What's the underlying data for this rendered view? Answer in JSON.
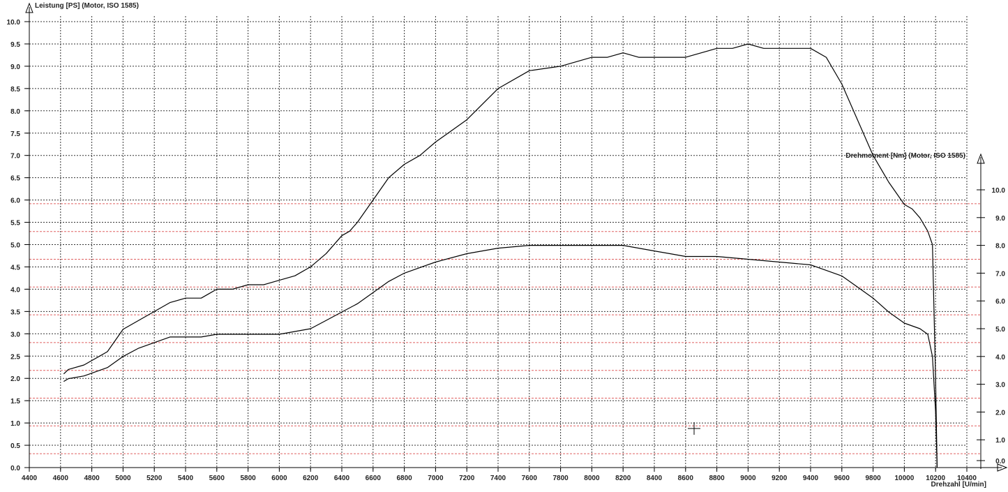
{
  "chart_data": {
    "type": "line",
    "ylabel_left": "Leistung [PS] (Motor, ISO 1585)",
    "ylabel_right": "Drehmoment [Nm] (Motor, ISO 1585)",
    "xlabel": "Drehzahl [U/min]",
    "xlim": [
      4400,
      10400
    ],
    "ylim_left": [
      0,
      10
    ],
    "ylim_right": [
      0,
      10
    ],
    "x_ticks": [
      "4400",
      "4600",
      "4800",
      "5000",
      "5200",
      "5400",
      "5600",
      "5800",
      "6000",
      "6200",
      "6400",
      "6600",
      "6800",
      "7000",
      "7200",
      "7400",
      "7600",
      "7800",
      "8000",
      "8200",
      "8400",
      "8600",
      "8800",
      "9000",
      "9200",
      "9400",
      "9600",
      "9800",
      "10000",
      "10200",
      "10400"
    ],
    "y_ticks_left": [
      "0.0",
      "0.5",
      "1.0",
      "1.5",
      "2.0",
      "2.5",
      "3.0",
      "3.5",
      "4.0",
      "4.5",
      "5.0",
      "5.5",
      "6.0",
      "6.5",
      "7.0",
      "7.5",
      "8.0",
      "8.5",
      "9.0",
      "9.5",
      "10.0"
    ],
    "y_ticks_right": [
      "0.0",
      "1.0",
      "2.0",
      "3.0",
      "4.0",
      "5.0",
      "6.0",
      "7.0",
      "8.0",
      "9.0",
      "10.0"
    ],
    "grid": true,
    "series": [
      {
        "axis": "left",
        "color": "#000000",
        "x": [
          4620,
          4650,
          4750,
          4800,
          4850,
          4900,
          5000,
          5100,
          5200,
          5300,
          5400,
          5500,
          5550,
          5600,
          5700,
          5800,
          5900,
          6000,
          6100,
          6200,
          6300,
          6400,
          6450,
          6500,
          6600,
          6700,
          6800,
          6900,
          7000,
          7200,
          7400,
          7600,
          7800,
          8000,
          8100,
          8200,
          8300,
          8400,
          8500,
          8600,
          8800,
          8900,
          9000,
          9100,
          9200,
          9300,
          9400,
          9500,
          9600,
          9700,
          9800,
          9900,
          10000,
          10050,
          10100,
          10150,
          10180,
          10200,
          10210
        ],
        "values": [
          2.1,
          2.2,
          2.3,
          2.4,
          2.5,
          2.6,
          3.1,
          3.3,
          3.5,
          3.7,
          3.8,
          3.8,
          3.9,
          4.0,
          4.0,
          4.1,
          4.1,
          4.2,
          4.3,
          4.5,
          4.8,
          5.2,
          5.3,
          5.5,
          6.0,
          6.5,
          6.8,
          7.0,
          7.3,
          7.8,
          8.5,
          8.9,
          9.0,
          9.2,
          9.2,
          9.3,
          9.2,
          9.2,
          9.2,
          9.2,
          9.4,
          9.4,
          9.5,
          9.4,
          9.4,
          9.4,
          9.4,
          9.2,
          8.6,
          7.8,
          7.0,
          6.4,
          5.9,
          5.8,
          5.6,
          5.3,
          5.0,
          2.0,
          0.0
        ]
      },
      {
        "axis": "right",
        "color": "#000000",
        "x": [
          4620,
          4650,
          4750,
          4800,
          4850,
          4900,
          5000,
          5100,
          5200,
          5300,
          5400,
          5500,
          5600,
          5700,
          5800,
          5900,
          6000,
          6100,
          6200,
          6300,
          6400,
          6500,
          6600,
          6700,
          6800,
          6900,
          7000,
          7200,
          7400,
          7600,
          7800,
          8000,
          8200,
          8300,
          8400,
          8500,
          8600,
          8700,
          8800,
          9000,
          9200,
          9400,
          9500,
          9600,
          9700,
          9800,
          9900,
          10000,
          10100,
          10150,
          10180,
          10200,
          10210
        ],
        "values": [
          3.1,
          3.2,
          3.3,
          3.4,
          3.5,
          3.6,
          4.0,
          4.3,
          4.5,
          4.7,
          4.7,
          4.7,
          4.8,
          4.8,
          4.8,
          4.8,
          4.8,
          4.9,
          5.0,
          5.3,
          5.6,
          5.9,
          6.3,
          6.7,
          7.0,
          7.2,
          7.4,
          7.7,
          7.9,
          8.0,
          8.0,
          8.0,
          8.0,
          7.9,
          7.8,
          7.7,
          7.6,
          7.6,
          7.6,
          7.5,
          7.4,
          7.3,
          7.1,
          6.9,
          6.5,
          6.1,
          5.6,
          5.2,
          5.0,
          4.8,
          4.0,
          2.0,
          0.0
        ]
      }
    ]
  }
}
